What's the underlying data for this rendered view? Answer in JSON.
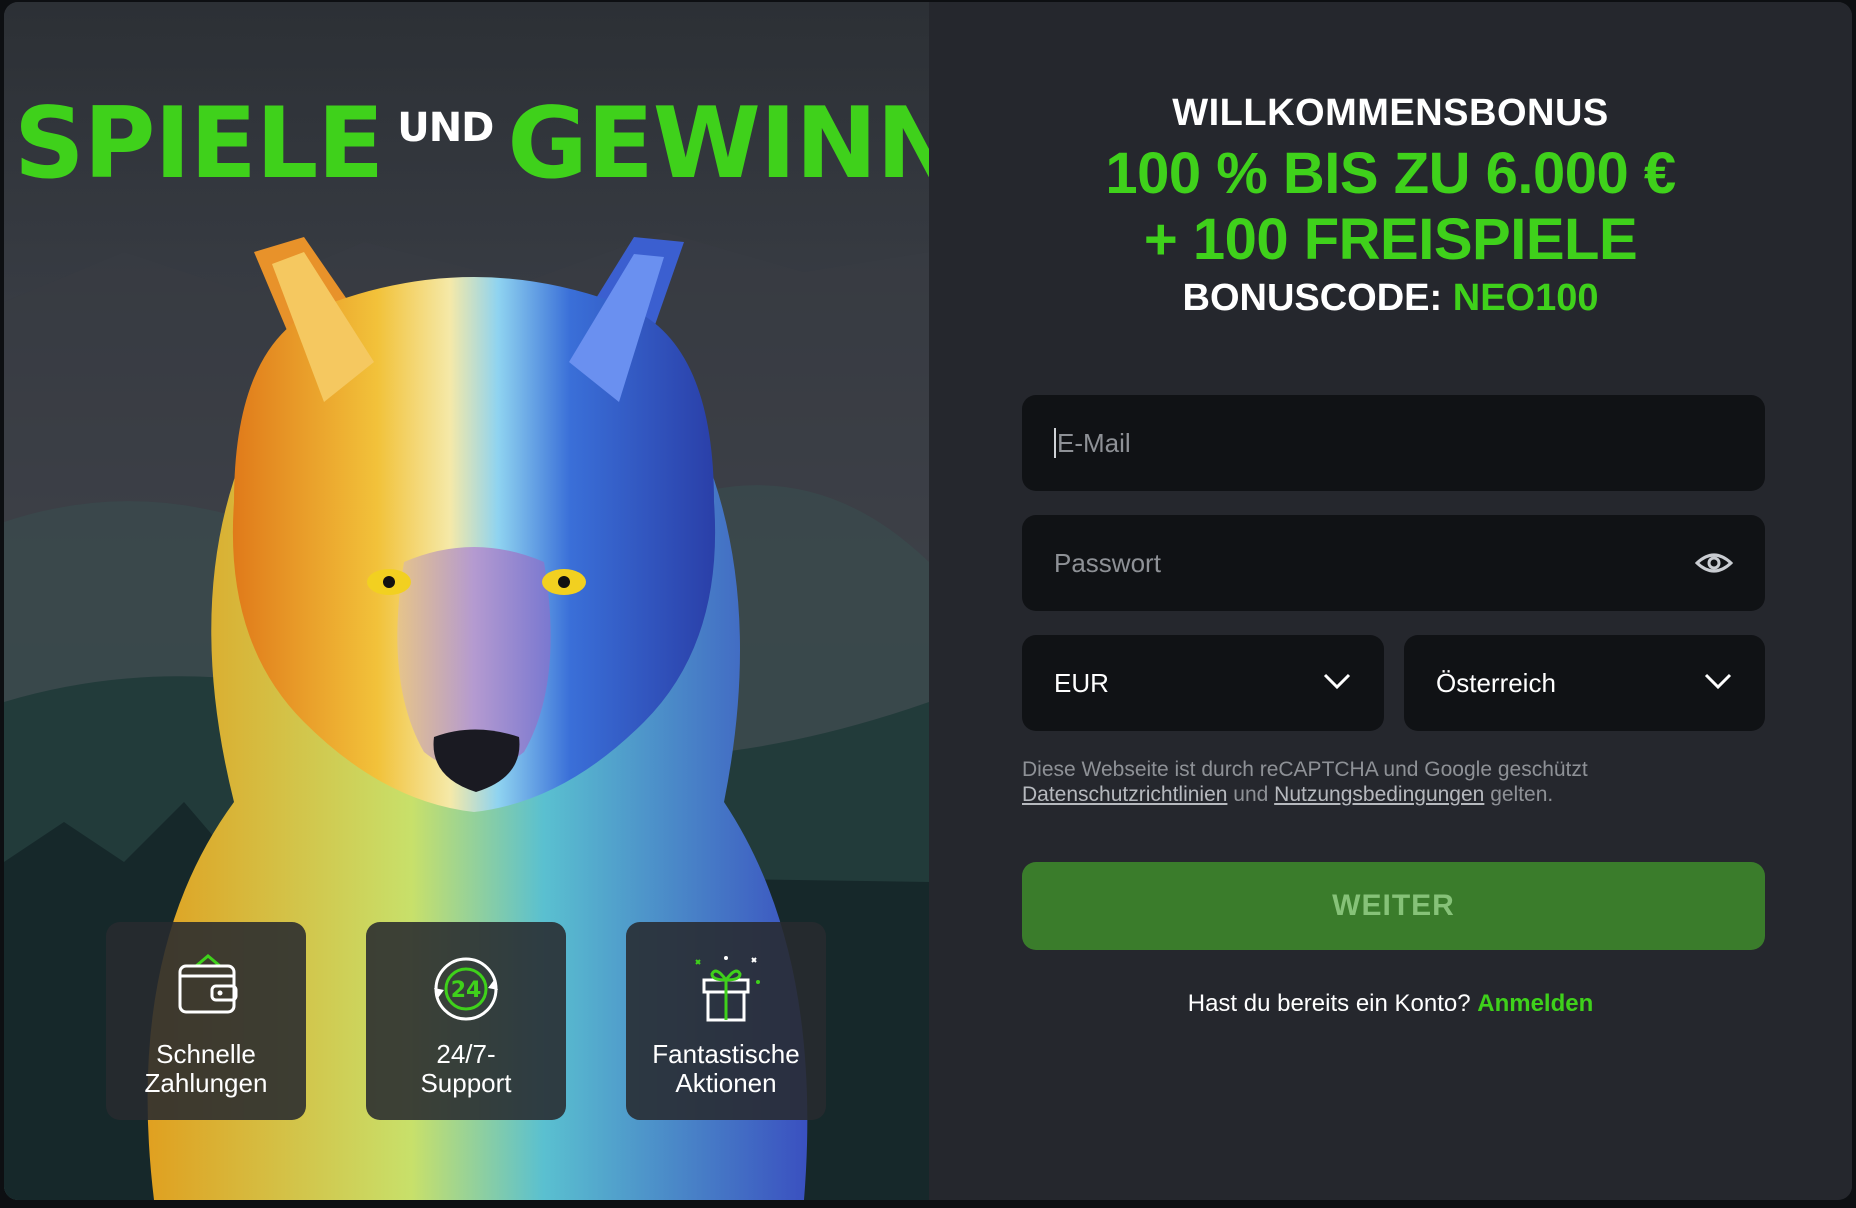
{
  "hero": {
    "word1": "SPIELE",
    "connector": "UND",
    "word2": "GEWINNE"
  },
  "features": [
    {
      "icon": "wallet-icon",
      "label": "Schnelle\nZahlungen"
    },
    {
      "icon": "support-24-icon",
      "label": "24/7-\nSupport"
    },
    {
      "icon": "gift-icon",
      "label": "Fantastische\nAktionen"
    }
  ],
  "bonus": {
    "title": "WILLKOMMENSBONUS",
    "line1": "100 % BIS ZU 6.000 €",
    "line2": "+ 100 FREISPIELE",
    "code_label": "BONUSCODE:",
    "code_value": "NEO100"
  },
  "form": {
    "email_placeholder": "E-Mail",
    "password_placeholder": "Passwort",
    "currency": "EUR",
    "country": "Österreich",
    "notice_text": "Diese Webseite ist durch reCAPTCHA und Google geschützt",
    "privacy_link": "Datenschutzrichtlinien",
    "and_word": "und",
    "terms_link": "Nutzungsbedingungen",
    "apply_word": "gelten.",
    "submit_label": "WEITER",
    "login_prompt": "Hast du bereits ein Konto?",
    "login_link": "Anmelden"
  },
  "colors": {
    "accent": "#3fd11b",
    "panel": "#25272d",
    "field": "#101215",
    "button": "#3a7c2b"
  }
}
